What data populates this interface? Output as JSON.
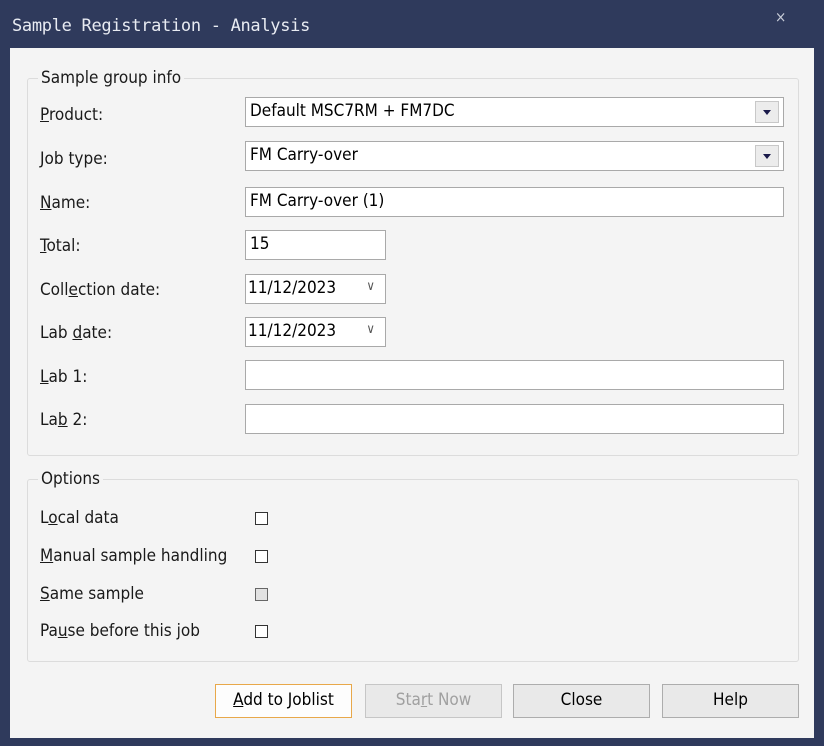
{
  "window": {
    "title": "Sample Registration - Analysis",
    "close_glyph": "×"
  },
  "sample_group": {
    "legend": "Sample group info",
    "product": {
      "label": "Product:",
      "key": "P",
      "value": "Default MSC7RM + FM7DC"
    },
    "job_type": {
      "label": "Job type:",
      "key": "J",
      "value": "FM Carry-over"
    },
    "name": {
      "label": "Name:",
      "key": "N",
      "value": "FM Carry-over (1)"
    },
    "total": {
      "label": "Total:",
      "key": "T",
      "value": "15"
    },
    "collection_date": {
      "label": "Collection date:",
      "key": "e",
      "value": "11/12/2023"
    },
    "lab_date": {
      "label": "Lab date:",
      "key": "d",
      "value": "11/12/2023"
    },
    "lab1": {
      "label": "Lab 1:",
      "key": "L",
      "value": ""
    },
    "lab2": {
      "label": "Lab 2:",
      "key": "b",
      "value": ""
    }
  },
  "options": {
    "legend": "Options",
    "items": [
      {
        "label": "Local data",
        "key": "o",
        "checked": false,
        "enabled": true
      },
      {
        "label": "Manual sample handling",
        "key": "M",
        "checked": false,
        "enabled": true
      },
      {
        "label": "Same sample",
        "key": "S",
        "checked": false,
        "enabled": false
      },
      {
        "label": "Pause before this job",
        "key": "u",
        "checked": false,
        "enabled": true
      }
    ]
  },
  "buttons": {
    "add": {
      "label": "Add to Joblist",
      "key": "A"
    },
    "start": {
      "label": "Start Now",
      "key": "r"
    },
    "close": {
      "label": "Close"
    },
    "help": {
      "label": "Help"
    }
  },
  "colors": {
    "frame": "#2f3a5c",
    "default_button_border": "#e8a84a"
  }
}
